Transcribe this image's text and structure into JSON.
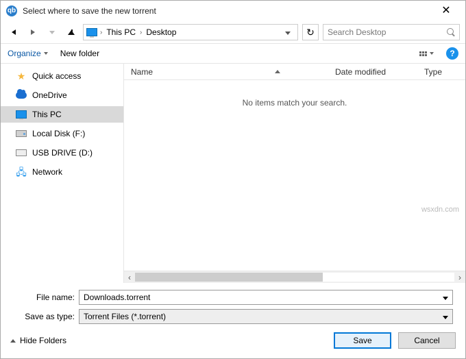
{
  "title": "Select where to save the new torrent",
  "close_glyph": "✕",
  "nav": {
    "refresh_glyph": "↻"
  },
  "breadcrumb": {
    "items": [
      "This PC",
      "Desktop"
    ]
  },
  "search": {
    "placeholder": "Search Desktop"
  },
  "toolbar": {
    "organize": "Organize",
    "new_folder": "New folder",
    "help_glyph": "?"
  },
  "sidebar": {
    "items": [
      {
        "label": "Quick access"
      },
      {
        "label": "OneDrive"
      },
      {
        "label": "This PC"
      },
      {
        "label": "Local Disk (F:)"
      },
      {
        "label": "USB DRIVE (D:)"
      },
      {
        "label": "Network"
      }
    ],
    "selected_index": 2
  },
  "columns": {
    "name": "Name",
    "date": "Date modified",
    "type": "Type"
  },
  "empty_message": "No items match your search.",
  "form": {
    "file_name_label": "File name:",
    "file_name_value": "Downloads.torrent",
    "save_type_label": "Save as type:",
    "save_type_value": "Torrent Files (*.torrent)"
  },
  "footer": {
    "hide_folders": "Hide Folders",
    "save": "Save",
    "cancel": "Cancel"
  },
  "watermark": "wsxdn.com"
}
